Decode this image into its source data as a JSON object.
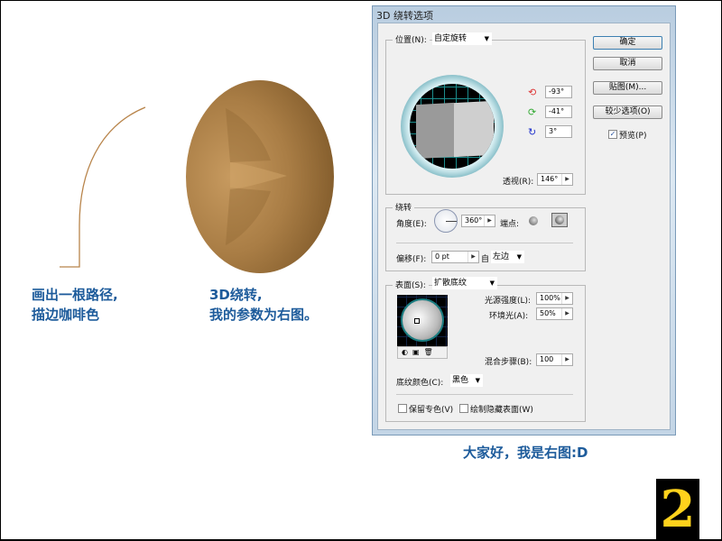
{
  "left_captions": {
    "step1_line1": "画出一根路径,",
    "step1_line2": "描边咖啡色",
    "step2_line1": "3D绕转,",
    "step2_line2": "我的参数为右图。"
  },
  "bottom_caption": "大家好，我是右图:D",
  "page_number": "2",
  "colors": {
    "caption": "#1d5b9b",
    "stroke": "#b8844a",
    "shape": "#a97d45"
  },
  "dialog": {
    "title": "3D 绕转选项",
    "position": {
      "label": "位置(N):",
      "value": "自定旋转",
      "rot_x": "-93°",
      "rot_y": "-41°",
      "rot_z": "3°",
      "perspective_label": "透视(R):",
      "perspective": "146°"
    },
    "revolve": {
      "label": "绕转",
      "angle_label": "角度(E):",
      "angle": "360°",
      "cap_label": "端点:",
      "offset_label": "偏移(F):",
      "offset": "0 pt",
      "from_label": "自",
      "from_value": "左边"
    },
    "surface": {
      "label": "表面(S):",
      "value": "扩散底纹",
      "light_intensity_label": "光源强度(L):",
      "light_intensity": "100%",
      "ambient_label": "环境光(A):",
      "ambient": "50%",
      "blend_steps_label": "混合步骤(B):",
      "blend_steps": "100",
      "shading_color_label": "底纹颜色(C):",
      "shading_color": "黑色",
      "preserve_spot_label": "保留专色(V)",
      "draw_hidden_label": "绘制隐藏表面(W)"
    },
    "buttons": {
      "ok": "确定",
      "cancel": "取消",
      "map": "贴图(M)...",
      "fewer": "较少选项(O)"
    },
    "preview_label": "预览(P)"
  }
}
